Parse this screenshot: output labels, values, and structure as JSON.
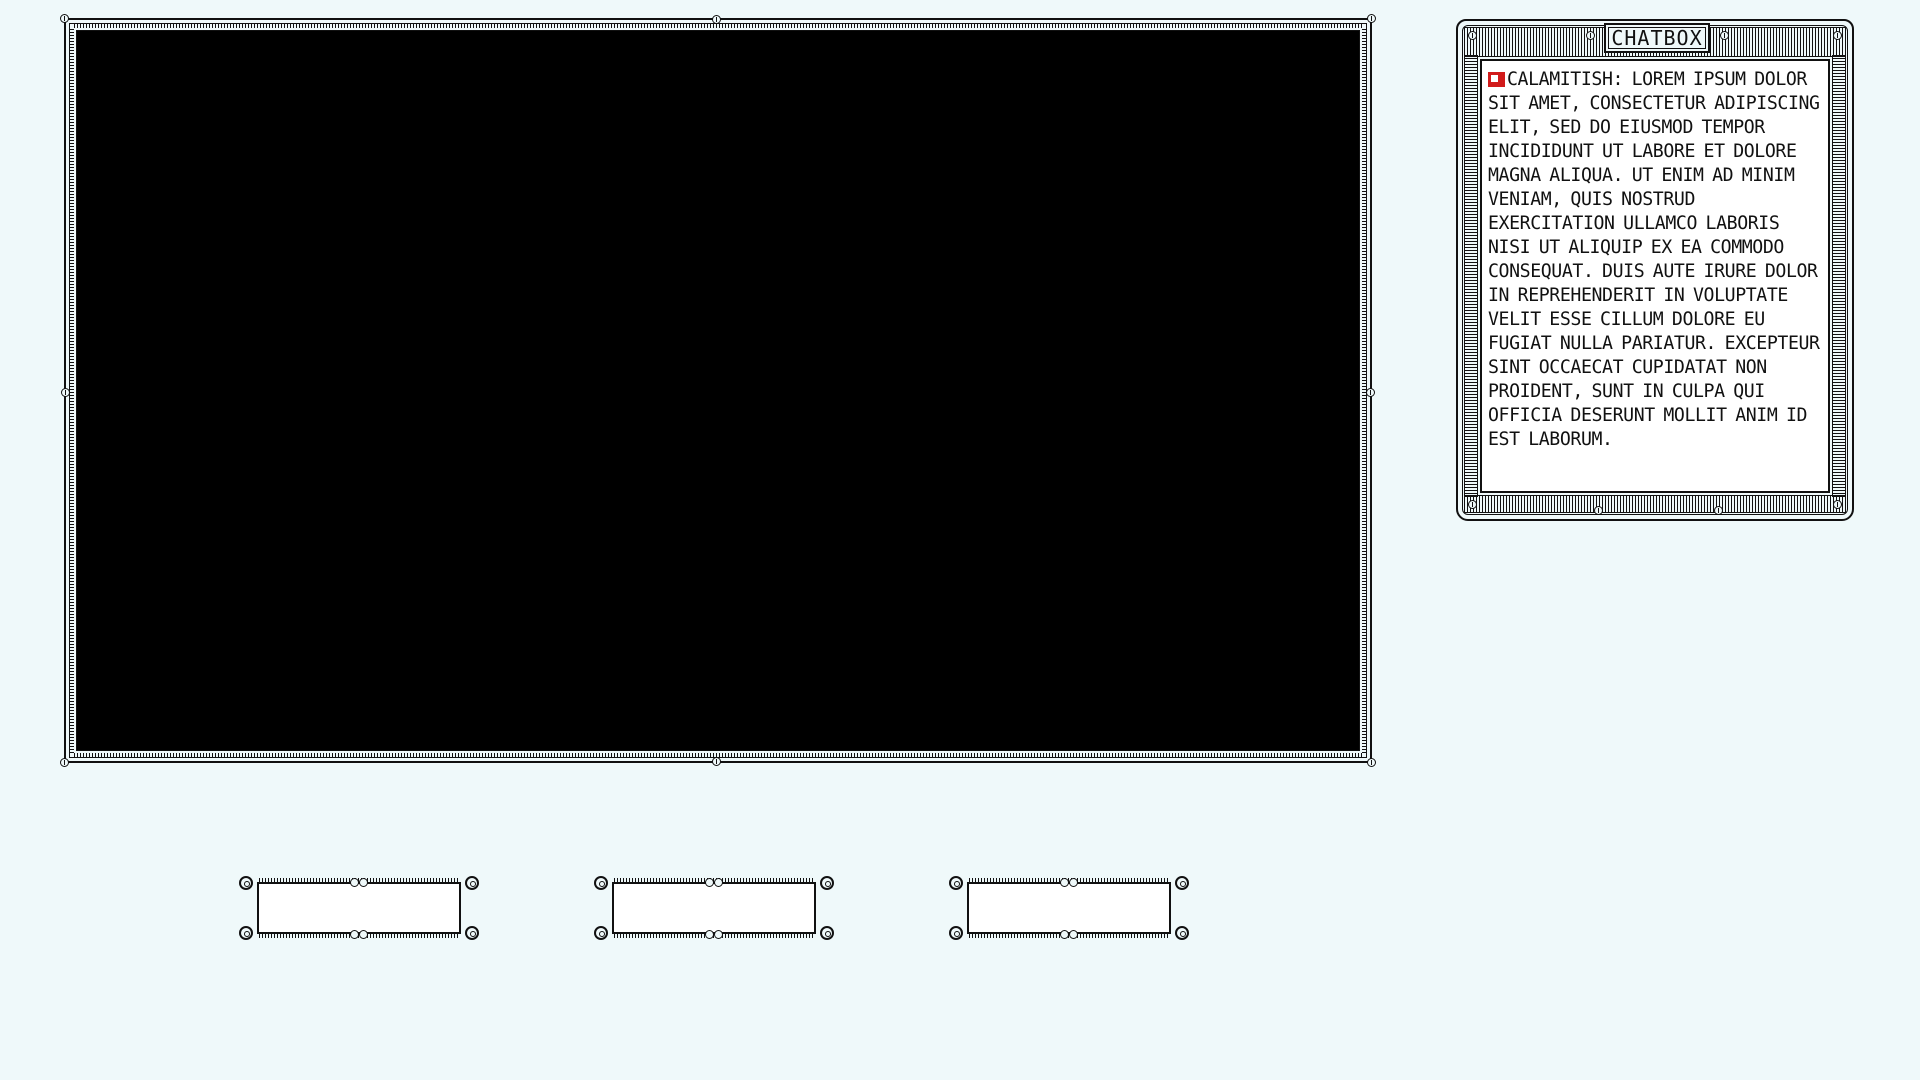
{
  "chatbox": {
    "title": "CHATBOX",
    "messages": [
      {
        "badge_color": "#d11b1b",
        "sender": "CALAMITISH:",
        "text": "LOREM IPSUM DOLOR SIT AMET, CONSECTETUR ADIPISCING ELIT, SED DO EIUSMOD TEMPOR INCIDIDUNT UT LABORE ET DOLORE MAGNA ALIQUA. UT ENIM AD MINIM VENIAM, QUIS NOSTRUD EXERCITATION ULLAMCO LABORIS NISI UT ALIQUIP EX EA COMMODO CONSEQUAT. DUIS AUTE IRURE DOLOR IN REPREHENDERIT IN VOLUPTATE VELIT ESSE CILLUM DOLORE EU FUGIAT NULLA PARIATUR. EXCEPTEUR SINT OCCAECAT CUPIDATAT NON PROIDENT, SUNT IN CULPA QUI OFFICIA DESERUNT MOLLIT ANIM ID EST LABORUM."
      }
    ]
  },
  "slots": [
    {
      "label": ""
    },
    {
      "label": ""
    },
    {
      "label": ""
    }
  ],
  "colors": {
    "background": "#eff9fa",
    "frame_ink": "#111111",
    "viewport": "#000000",
    "badge": "#d11b1b"
  }
}
